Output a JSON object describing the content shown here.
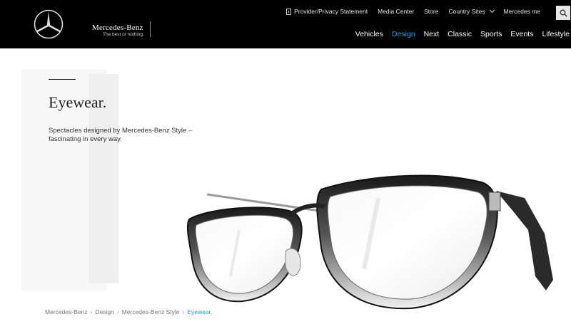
{
  "brand": {
    "name": "Mercedes-Benz",
    "tagline": "The best or nothing."
  },
  "utility_nav": {
    "provider": "Provider/Privacy Statement",
    "media": "Media Center",
    "store": "Store",
    "country": "Country Sites",
    "me": "Mercedes me"
  },
  "main_nav": [
    "Vehicles",
    "Design",
    "Next",
    "Classic",
    "Sports",
    "Events",
    "Lifestyle"
  ],
  "main_nav_active": "Design",
  "page": {
    "title": "Eyewear.",
    "intro": "Spectacles designed by Mercedes-Benz Style – fascinating in every way."
  },
  "breadcrumb": [
    "Mercedes-Benz",
    "Design",
    "Mercedes-Benz Style",
    "Eyewear."
  ],
  "colors": {
    "accent": "#2a9bd8",
    "header_bg": "#000000"
  },
  "icons": {
    "logo": "mercedes-star-icon",
    "search": "search-icon",
    "document": "document-icon",
    "chevron": "chevron-down-icon"
  }
}
